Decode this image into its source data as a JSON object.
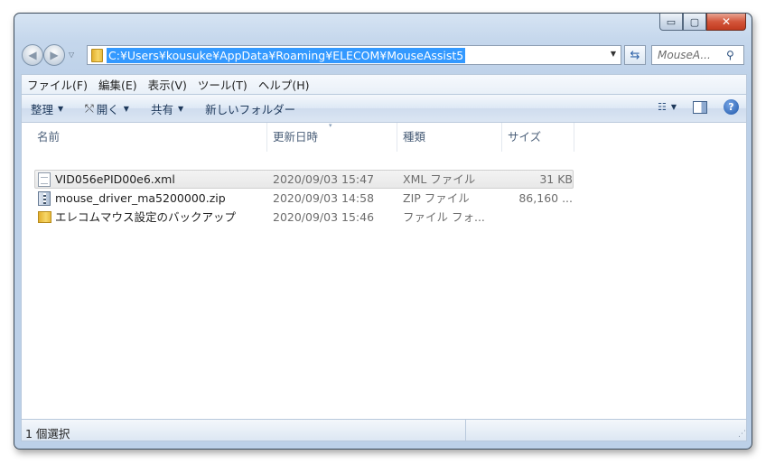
{
  "window": {
    "minimize_glyph": "▭",
    "maximize_glyph": "▢",
    "close_glyph": "✕"
  },
  "navbar": {
    "back_glyph": "◀",
    "forward_glyph": "▶",
    "history_glyph": "▽",
    "address": "C:¥Users¥kousuke¥AppData¥Roaming¥ELECOM¥MouseAssist5",
    "address_dropdown_glyph": "▼",
    "refresh_glyph": "⇆",
    "search_placeholder": "MouseA...",
    "search_glyph": "⚲"
  },
  "menubar": {
    "items": [
      "ファイル(F)",
      "編集(E)",
      "表示(V)",
      "ツール(T)",
      "ヘルプ(H)"
    ]
  },
  "toolbar": {
    "organize": "整理",
    "open": "開く",
    "open_glyph": "⤲",
    "share": "共有",
    "new_folder": "新しいフォルダー",
    "caret": "▼",
    "views_glyph": "☷",
    "help_glyph": "?"
  },
  "columns": {
    "name": "名前",
    "date": "更新日時",
    "type": "種類",
    "size": "サイズ",
    "sort_glyph": "▾"
  },
  "files": [
    {
      "name": "VID056ePID00e6.xml",
      "date": "2020/09/03 15:47",
      "type": "XML ファイル",
      "size": "31 KB",
      "icon": "xml-file-icon",
      "selected": true
    },
    {
      "name": "mouse_driver_ma5200000.zip",
      "date": "2020/09/03 14:58",
      "type": "ZIP ファイル",
      "size": "86,160 ...",
      "icon": "zip-file-icon",
      "selected": false
    },
    {
      "name": "エレコムマウス設定のバックアップ",
      "date": "2020/09/03 15:46",
      "type": "ファイル フォ...",
      "size": "",
      "icon": "folder-icon",
      "selected": false
    }
  ],
  "statusbar": {
    "selection": "1 個選択",
    "grip_glyph": "⋰"
  }
}
